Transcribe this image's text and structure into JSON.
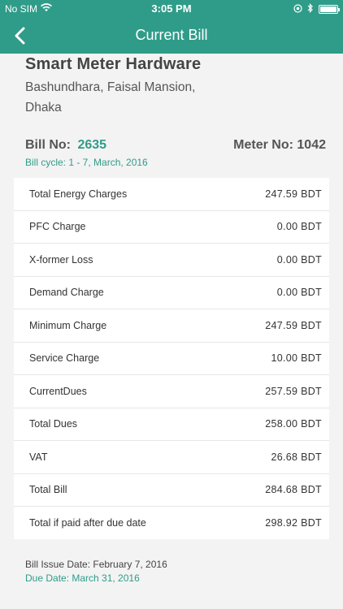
{
  "status_bar": {
    "carrier": "No SIM",
    "time": "3:05 PM"
  },
  "nav": {
    "title": "Current Bill"
  },
  "company": {
    "name": "Smart Meter  Hardware",
    "address_line1": "Bashundhara, Faisal Mansion,",
    "address_line2": "Dhaka"
  },
  "bill": {
    "bill_no_label": "Bill No:",
    "bill_no": "2635",
    "meter_label": "Meter No: 1042",
    "cycle": "Bill cycle: 1 - 7, March, 2016"
  },
  "charges": [
    {
      "label": "Total Energy Charges",
      "value": "247.59 BDT"
    },
    {
      "label": "PFC Charge",
      "value": "0.00 BDT"
    },
    {
      "label": "X-former Loss",
      "value": "0.00 BDT"
    },
    {
      "label": "Demand Charge",
      "value": "0.00 BDT"
    },
    {
      "label": "Minimum Charge",
      "value": "247.59 BDT"
    },
    {
      "label": "Service Charge",
      "value": "10.00 BDT"
    },
    {
      "label": "CurrentDues",
      "value": "257.59 BDT"
    },
    {
      "label": "Total Dues",
      "value": "258.00 BDT"
    },
    {
      "label": "VAT",
      "value": "26.68 BDT"
    },
    {
      "label": "Total Bill",
      "value": "284.68 BDT"
    },
    {
      "label": "Total if paid after due date",
      "value": "298.92 BDT"
    }
  ],
  "footer": {
    "issue_date": "Bill Issue Date: February 7, 2016",
    "due_date": "Due Date: March 31, 2016"
  },
  "colors": {
    "accent": "#2f9c89"
  },
  "icons": [
    "wifi-icon",
    "location-icon",
    "bluetooth-icon",
    "battery-icon",
    "back-chevron-icon"
  ]
}
